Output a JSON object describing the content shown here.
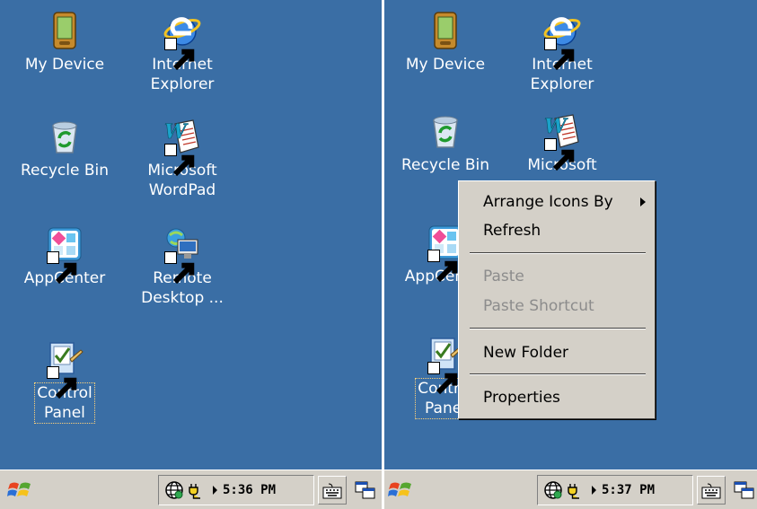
{
  "desktop": {
    "icons": [
      {
        "id": "my-device",
        "label": "My Device",
        "icon": "pda-device-icon"
      },
      {
        "id": "internet-explorer",
        "label_line1": "Internet",
        "label_line2": "Explorer",
        "icon": "internet-explorer-icon",
        "shortcut": true
      },
      {
        "id": "recycle-bin",
        "label": "Recycle Bin",
        "icon": "recycle-bin-icon"
      },
      {
        "id": "wordpad",
        "label_line1": "Microsoft",
        "label_line2": "WordPad",
        "icon": "wordpad-icon",
        "shortcut": true
      },
      {
        "id": "appcenter",
        "label": "AppCenter",
        "icon": "appcenter-icon",
        "shortcut": true
      },
      {
        "id": "remote-desktop",
        "label_line1": "Remote",
        "label_line2": "Desktop ...",
        "icon": "remote-desktop-icon",
        "shortcut": true
      },
      {
        "id": "control-panel",
        "label_line1": "Control",
        "label_line2": "Panel",
        "icon": "control-panel-icon",
        "shortcut": true
      }
    ],
    "right_partial_labels": {
      "recycle": "Recycle Bin",
      "wordpad_line1": "Microsoft",
      "appcenter": "AppCenter",
      "control_line1": "Control",
      "control_line2": "Panel"
    }
  },
  "context_menu": {
    "arrange_icons": "Arrange Icons By",
    "refresh": "Refresh",
    "paste": "Paste",
    "paste_shortcut": "Paste Shortcut",
    "new_folder": "New Folder",
    "properties": "Properties"
  },
  "taskbar_left": {
    "clock": "5:36 PM"
  },
  "taskbar_right": {
    "clock": "5:37 PM"
  },
  "colors": {
    "desktop": "#3a6ea5",
    "taskbar": "#d4d0c8",
    "menu": "#d4d0c8",
    "disabled_text": "#8c8c8c"
  }
}
